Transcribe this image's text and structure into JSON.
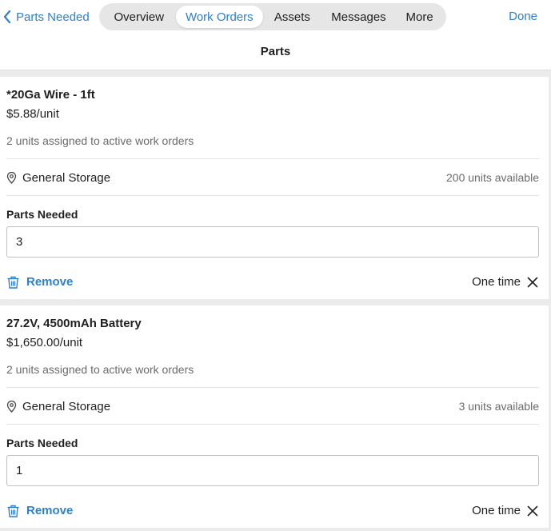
{
  "header": {
    "back_label": "Parts Needed",
    "tabs": [
      {
        "label": "Overview",
        "active": false
      },
      {
        "label": "Work Orders",
        "active": true
      },
      {
        "label": "Assets",
        "active": false
      },
      {
        "label": "Messages",
        "active": false
      },
      {
        "label": "More",
        "active": false
      }
    ],
    "done_label": "Done",
    "title": "Parts"
  },
  "parts": [
    {
      "name": "*20Ga Wire - 1ft",
      "price": "$5.88/unit",
      "assigned": "2 units assigned to active work orders",
      "location_icon": "map-pin-icon",
      "location": "General Storage",
      "available": "200 units available",
      "needed_label": "Parts Needed",
      "needed_value": "3",
      "remove_icon": "trash-icon",
      "remove_label": "Remove",
      "frequency": "One time"
    },
    {
      "name": "27.2V, 4500mAh Battery",
      "price": "$1,650.00/unit",
      "assigned": "2 units assigned to active work orders",
      "location_icon": "map-pin-icon",
      "location": "General Storage",
      "available": "3 units available",
      "needed_label": "Parts Needed",
      "needed_value": "1",
      "remove_icon": "trash-icon",
      "remove_label": "Remove",
      "frequency": "One time"
    }
  ],
  "colors": {
    "accent": "#2f7fd0",
    "text": "#1f1f1f",
    "muted": "#6b6b6b",
    "background": "#ebebeb"
  }
}
